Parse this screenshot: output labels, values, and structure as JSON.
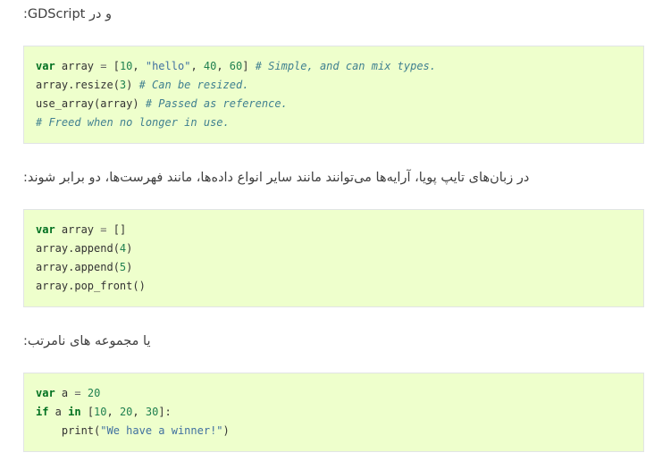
{
  "paragraphs": [
    {
      "text": "و در GDScript:"
    },
    {
      "text": "در زبان‌های تایپ پویا، آرایه‌ها می‌توانند مانند سایر انواع داده‌ها، مانند فهرست‌ها، دو برابر شوند:"
    },
    {
      "text": "یا مجموعه های نامرتب:"
    }
  ],
  "code_blocks": [
    {
      "lines": [
        [
          {
            "t": "kw",
            "v": "var"
          },
          {
            "t": "",
            "v": " array "
          },
          {
            "t": "op",
            "v": "="
          },
          {
            "t": "",
            "v": " ["
          },
          {
            "t": "num",
            "v": "10"
          },
          {
            "t": "",
            "v": ", "
          },
          {
            "t": "str",
            "v": "\"hello\""
          },
          {
            "t": "",
            "v": ", "
          },
          {
            "t": "num",
            "v": "40"
          },
          {
            "t": "",
            "v": ", "
          },
          {
            "t": "num",
            "v": "60"
          },
          {
            "t": "",
            "v": "] "
          },
          {
            "t": "cm",
            "v": "# Simple, and can mix types."
          }
        ],
        [
          {
            "t": "",
            "v": "array.resize("
          },
          {
            "t": "num",
            "v": "3"
          },
          {
            "t": "",
            "v": ") "
          },
          {
            "t": "cm",
            "v": "# Can be resized."
          }
        ],
        [
          {
            "t": "",
            "v": "use_array(array) "
          },
          {
            "t": "cm",
            "v": "# Passed as reference."
          }
        ],
        [
          {
            "t": "cm",
            "v": "# Freed when no longer in use."
          }
        ]
      ]
    },
    {
      "lines": [
        [
          {
            "t": "kw",
            "v": "var"
          },
          {
            "t": "",
            "v": " array "
          },
          {
            "t": "op",
            "v": "="
          },
          {
            "t": "",
            "v": " []"
          }
        ],
        [
          {
            "t": "",
            "v": "array.append("
          },
          {
            "t": "num",
            "v": "4"
          },
          {
            "t": "",
            "v": ")"
          }
        ],
        [
          {
            "t": "",
            "v": "array.append("
          },
          {
            "t": "num",
            "v": "5"
          },
          {
            "t": "",
            "v": ")"
          }
        ],
        [
          {
            "t": "",
            "v": "array.pop_front()"
          }
        ]
      ]
    },
    {
      "lines": [
        [
          {
            "t": "kw",
            "v": "var"
          },
          {
            "t": "",
            "v": " a "
          },
          {
            "t": "op",
            "v": "="
          },
          {
            "t": "",
            "v": " "
          },
          {
            "t": "num",
            "v": "20"
          }
        ],
        [
          {
            "t": "kw",
            "v": "if"
          },
          {
            "t": "",
            "v": " a "
          },
          {
            "t": "kw",
            "v": "in"
          },
          {
            "t": "",
            "v": " ["
          },
          {
            "t": "num",
            "v": "10"
          },
          {
            "t": "",
            "v": ", "
          },
          {
            "t": "num",
            "v": "20"
          },
          {
            "t": "",
            "v": ", "
          },
          {
            "t": "num",
            "v": "30"
          },
          {
            "t": "",
            "v": "]:"
          }
        ],
        [
          {
            "t": "",
            "v": "    print("
          },
          {
            "t": "str",
            "v": "\"We have a winner!\""
          },
          {
            "t": "",
            "v": ")"
          }
        ]
      ]
    }
  ],
  "colors": {
    "code_background": "#eeffcc",
    "code_border": "#e1e4e5",
    "keyword": "#007020",
    "number": "#208050",
    "string": "#4070a0",
    "comment": "#408090",
    "body_text": "#404040"
  }
}
